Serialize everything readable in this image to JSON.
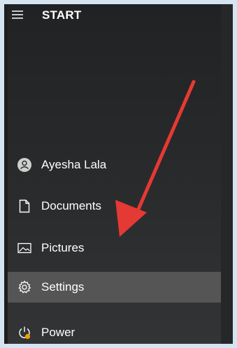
{
  "start_menu": {
    "title": "START",
    "items": [
      {
        "label": "Ayesha Lala",
        "icon": "user-avatar-icon"
      },
      {
        "label": "Documents",
        "icon": "document-icon"
      },
      {
        "label": "Pictures",
        "icon": "pictures-icon"
      },
      {
        "label": "Settings",
        "icon": "gear-icon",
        "active": true
      },
      {
        "label": "Power",
        "icon": "power-icon"
      }
    ]
  },
  "colors": {
    "arrow": "#e53935",
    "active_item": "#555556",
    "power_dot": "#f0a000"
  }
}
